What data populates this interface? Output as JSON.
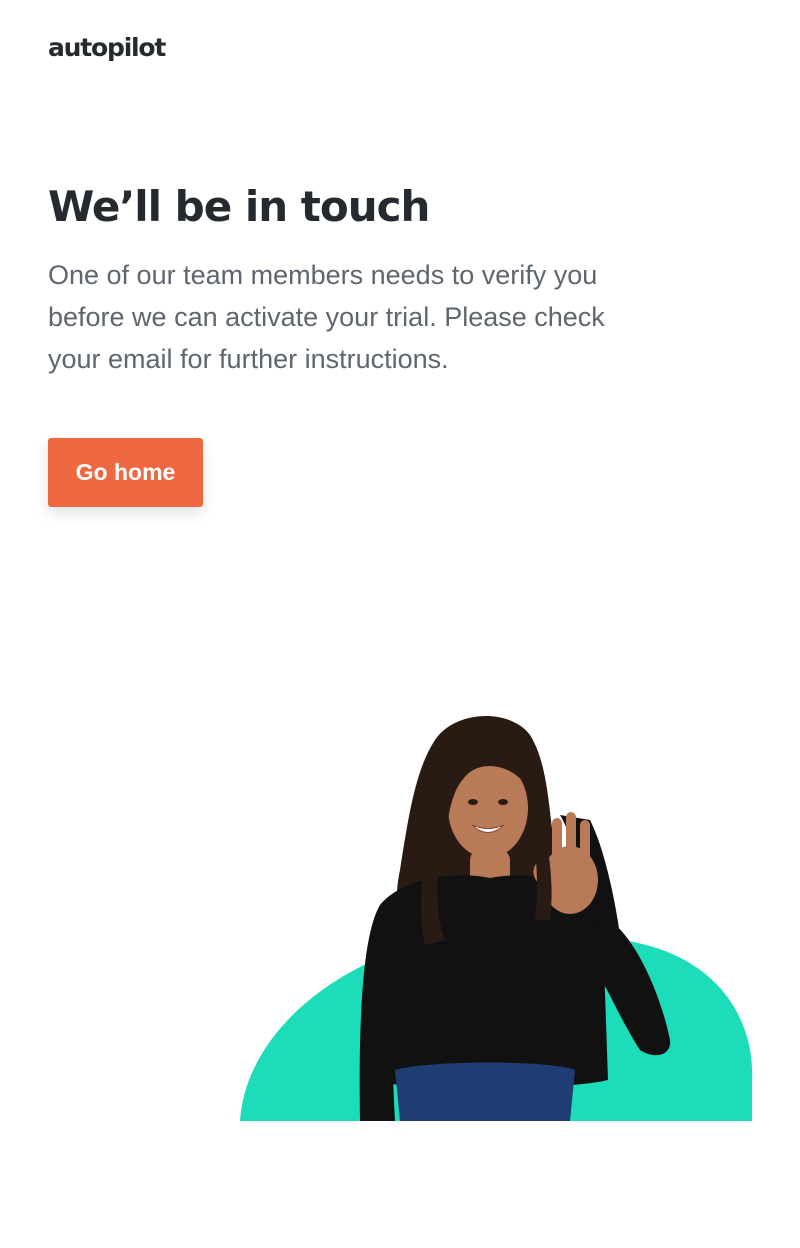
{
  "brand": {
    "logo_text": "autopilot"
  },
  "main": {
    "headline": "We’ll be in touch",
    "body": "One of our team members needs to verify you before we can activate your trial. Please check your email for further instructions.",
    "go_home_label": "Go home"
  },
  "colors": {
    "accent": "#ee6842",
    "blob": "#1ddcba",
    "text_dark": "#252a30",
    "text_muted": "#5e6670"
  },
  "illustration": {
    "icon": "smiling-woman-ok-gesture-photo"
  }
}
